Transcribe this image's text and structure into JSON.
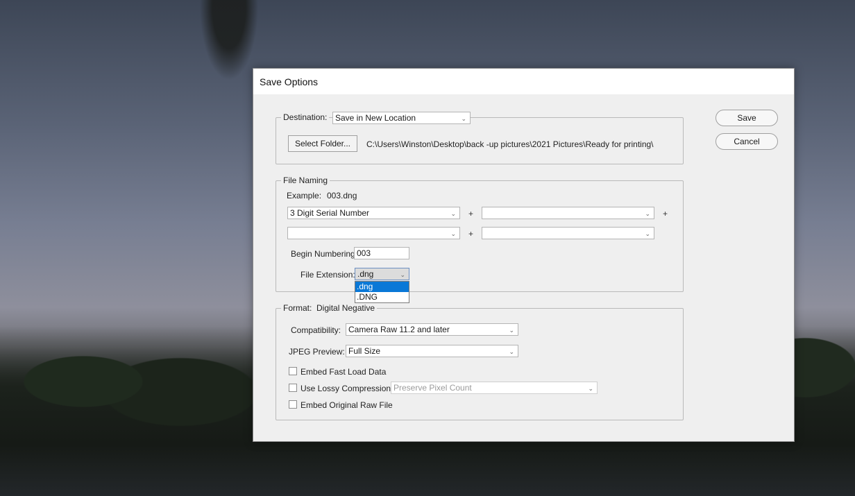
{
  "dialog": {
    "title": "Save Options"
  },
  "destination": {
    "label": "Destination:",
    "value": "Save in New Location",
    "select_folder_label": "Select Folder...",
    "path": "C:\\Users\\Winston\\Desktop\\back -up pictures\\2021 Pictures\\Ready for printing\\"
  },
  "file_naming": {
    "legend": "File Naming",
    "example_label": "Example:",
    "example_value": "003.dng",
    "token1": "3 Digit Serial Number",
    "token2": "",
    "token3": "",
    "token4": "",
    "plus": "+",
    "begin_label": "Begin Numbering:",
    "begin_value": "003",
    "ext_label": "File Extension:",
    "ext_value": ".dng",
    "ext_options": [
      ".dng",
      ".DNG"
    ]
  },
  "format": {
    "legend": "Format:",
    "value": "Digital Negative",
    "compat_label": "Compatibility:",
    "compat_value": "Camera Raw 11.2 and later",
    "jpeg_label": "JPEG Preview:",
    "jpeg_value": "Full Size",
    "embed_fast_label": "Embed Fast Load Data",
    "lossy_label": "Use Lossy Compression:",
    "lossy_value": "Preserve Pixel Count",
    "embed_raw_label": "Embed Original Raw File"
  },
  "buttons": {
    "save": "Save",
    "cancel": "Cancel"
  },
  "icons": {
    "chevron": "chevron-down-icon"
  }
}
